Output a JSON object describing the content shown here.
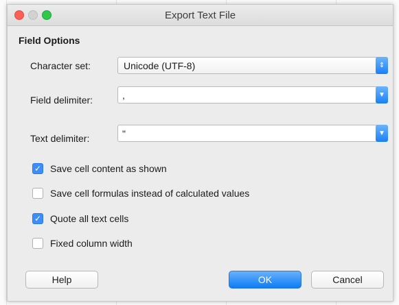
{
  "window": {
    "title": "Export Text File"
  },
  "section": {
    "title": "Field Options"
  },
  "fields": {
    "charset": {
      "label": "Character set:",
      "value": "Unicode (UTF-8)"
    },
    "field_delim": {
      "label": "Field delimiter:",
      "value": ","
    },
    "text_delim": {
      "label": "Text delimiter:",
      "value": "\""
    }
  },
  "options": [
    {
      "label": "Save cell content as shown",
      "checked": true
    },
    {
      "label": "Save cell formulas instead of calculated values",
      "checked": false
    },
    {
      "label": "Quote all text cells",
      "checked": true
    },
    {
      "label": "Fixed column width",
      "checked": false
    }
  ],
  "buttons": {
    "help": "Help",
    "ok": "OK",
    "cancel": "Cancel"
  },
  "icons": {
    "check": "checkmark-icon",
    "updown": "chevron-updown-icon",
    "down": "chevron-down-icon"
  },
  "colors": {
    "accent": "#1a80f7",
    "close": "#fc5f57",
    "zoom": "#30c84a"
  }
}
